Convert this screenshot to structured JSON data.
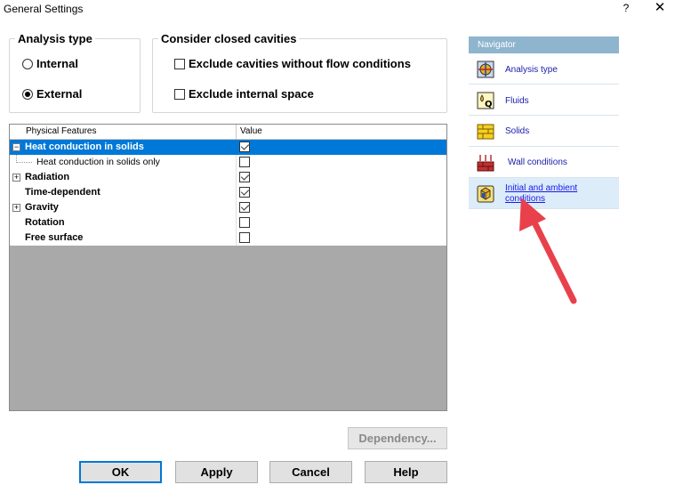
{
  "window": {
    "title": "General Settings",
    "help_label": "?",
    "close_label": "✕"
  },
  "analysis_type": {
    "title": "Analysis type",
    "options": [
      {
        "label": "Internal",
        "selected": false
      },
      {
        "label": "External",
        "selected": true
      }
    ]
  },
  "cavities": {
    "title": "Consider closed cavities",
    "options": [
      {
        "label": "Exclude cavities without flow conditions",
        "checked": false
      },
      {
        "label": "Exclude internal space",
        "checked": false
      }
    ]
  },
  "grid": {
    "headers": [
      "Physical Features",
      "Value"
    ],
    "rows": [
      {
        "label": "Heat conduction in solids",
        "checked": true,
        "bold": true,
        "selected": true,
        "expander": "−"
      },
      {
        "label": "Heat conduction in solids only",
        "checked": false,
        "bold": false,
        "selected": false,
        "child": true
      },
      {
        "label": "Radiation",
        "checked": true,
        "bold": true,
        "selected": false,
        "expander": "+"
      },
      {
        "label": "Time-dependent",
        "checked": true,
        "bold": true,
        "selected": false
      },
      {
        "label": "Gravity",
        "checked": true,
        "bold": true,
        "selected": false,
        "expander": "+"
      },
      {
        "label": "Rotation",
        "checked": false,
        "bold": true,
        "selected": false
      },
      {
        "label": "Free surface",
        "checked": false,
        "bold": true,
        "selected": false
      }
    ]
  },
  "buttons": {
    "dependency": "Dependency...",
    "ok": "OK",
    "apply": "Apply",
    "cancel": "Cancel",
    "help": "Help"
  },
  "navigator": {
    "title": "Navigator",
    "items": [
      {
        "label": "Analysis type",
        "icon": "analysis-type-icon"
      },
      {
        "label": "Fluids",
        "icon": "fluids-icon"
      },
      {
        "label": "Solids",
        "icon": "solids-icon"
      },
      {
        "label": "Wall conditions",
        "icon": "wall-conditions-icon"
      },
      {
        "label_line1": "Initial and ambient",
        "label_line2": "conditions",
        "icon": "initial-conditions-icon",
        "highlighted": true
      }
    ]
  },
  "colors": {
    "selection": "#0078d7",
    "navigator_header": "#8fb4cd",
    "arrow": "#e8414b"
  }
}
